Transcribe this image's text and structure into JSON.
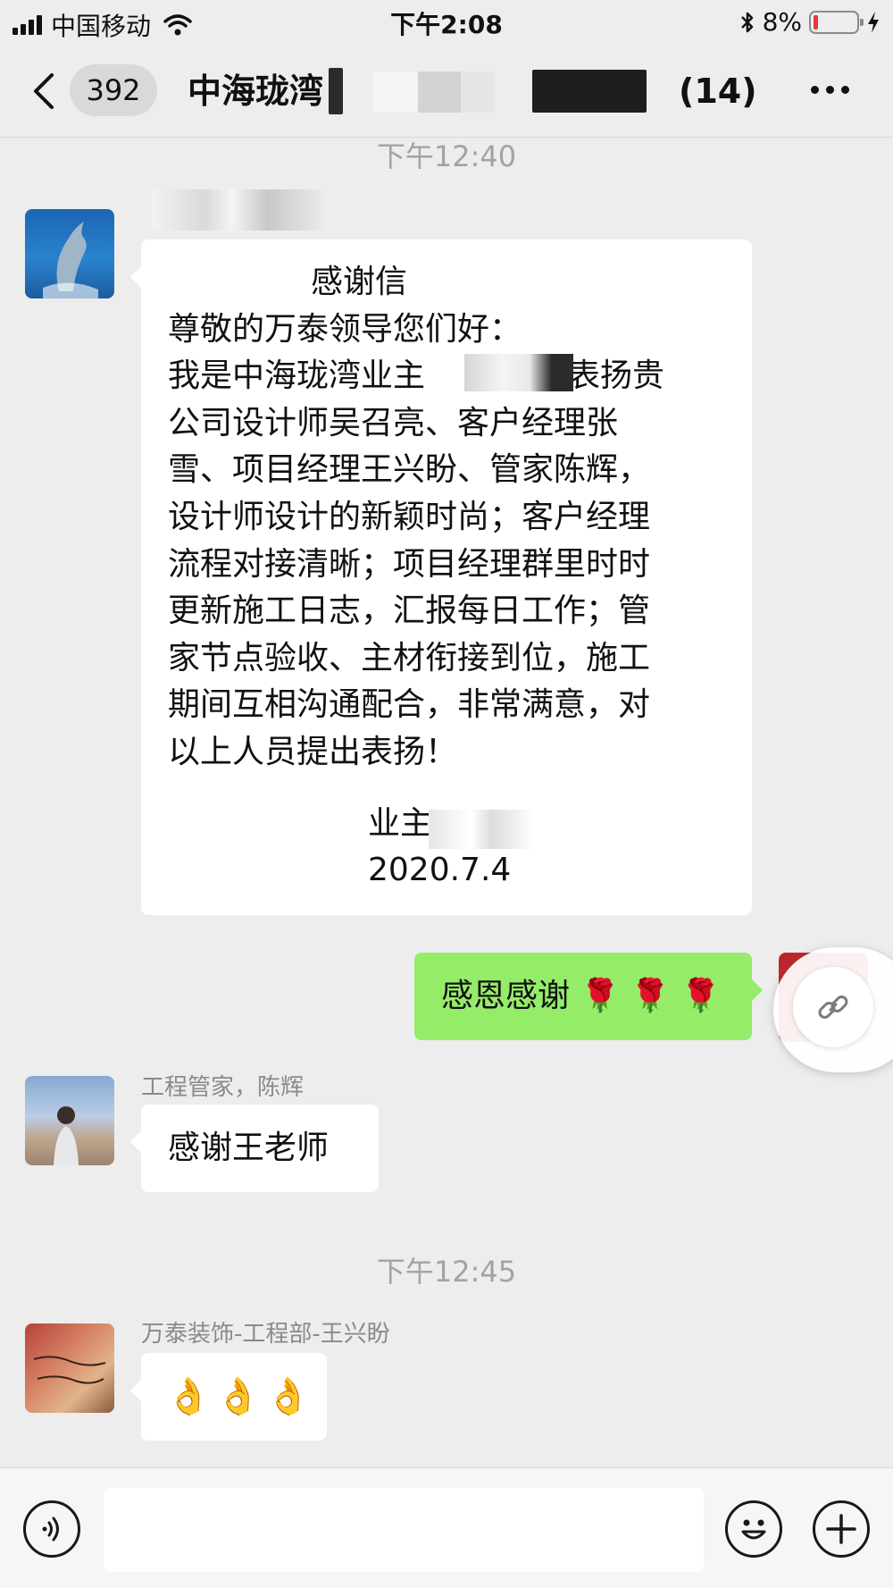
{
  "status_bar": {
    "carrier": "中国移动",
    "time": "下午2:08",
    "battery": "8%",
    "battery_level": 0.08
  },
  "header": {
    "unread_count": "392",
    "title": "中海珑湾",
    "member_count": "(14)"
  },
  "messages": {
    "timestamp_1": "下午12:40",
    "letter": {
      "title": "感谢信",
      "lines": [
        "尊敬的万泰领导您们好：",
        "我是中海珑湾业主",
        "，表扬贵",
        "公司设计师吴召亮、客户经理张",
        "雪、项目经理王兴盼、管家陈辉，",
        "设计师设计的新颖时尚；客户经理",
        "流程对接清晰；项目经理群里时时",
        "更新施工日志，汇报每日工作；管",
        "家节点验收、主材衔接到位，施工",
        "期间互相沟通配合，非常满意，对",
        "以上人员提出表扬！"
      ],
      "signature": "业主",
      "date": "2020.7.4"
    },
    "my_reply": "感恩感谢 🌹 🌹 🌹",
    "sender_2": "工程管家，陈辉",
    "reply_2": "感谢王老师",
    "timestamp_2": "下午12:45",
    "sender_3": "万泰装饰-工程部-王兴盼",
    "reply_3": "👌👌👌"
  },
  "icons": {
    "back": "chevron-left-icon",
    "more": "more-dots-icon",
    "link": "link-icon",
    "voice": "voice-icon",
    "emoji": "emoji-icon",
    "plus": "plus-icon"
  },
  "colors": {
    "background": "#ededed",
    "my_bubble": "#95ec69",
    "their_bubble": "#ffffff",
    "battery_low": "#e53935"
  }
}
